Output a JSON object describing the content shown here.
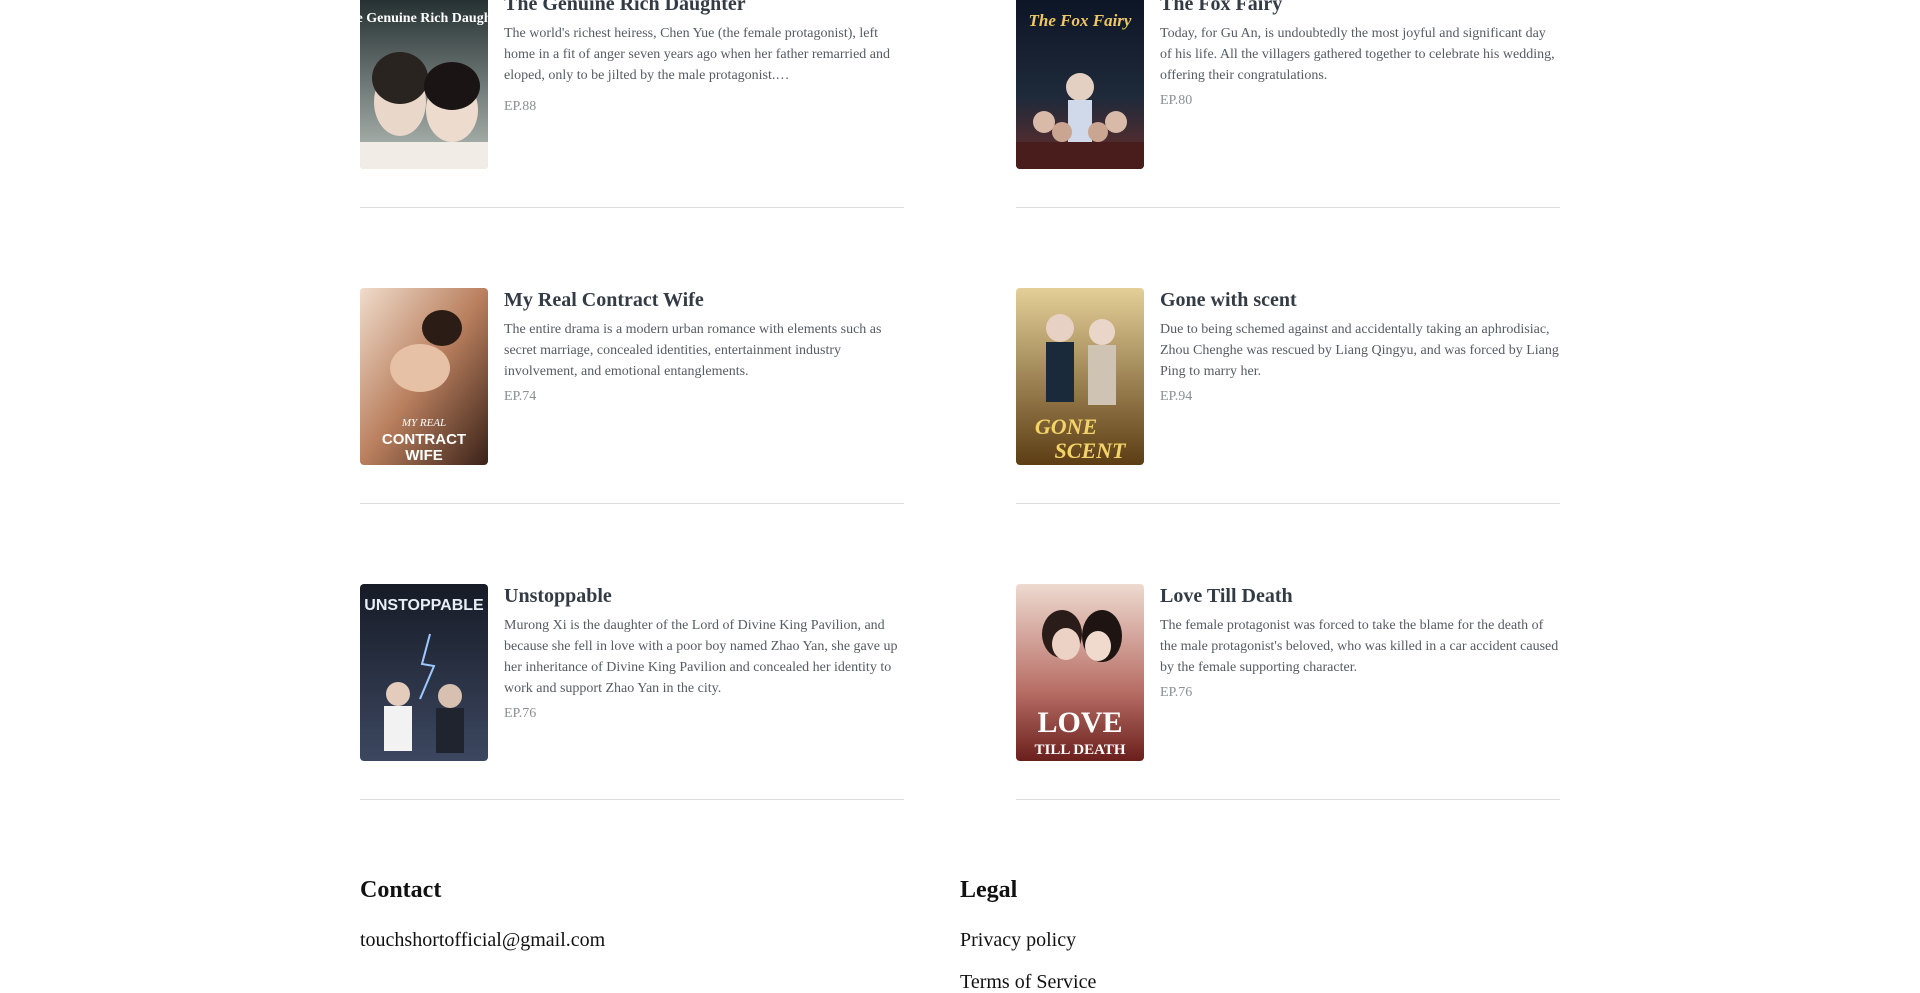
{
  "dramas": [
    {
      "title": "The Genuine Rich Daughter",
      "description": "The world's richest heiress, Chen Yue (the female protagonist), left home in a fit of anger seven years ago when her father remarried and eloped, only to be jilted by the male protagonist.…",
      "episodes": "EP.88",
      "poster_text": "The Genuine Rich Daughter",
      "poster_colors": [
        "#2e3a3a",
        "#a7b2ab"
      ]
    },
    {
      "title": "The Fox Fairy",
      "description": "Today, for Gu An, is undoubtedly the most joyful and significant day of his life. All the villagers gathered together to celebrate his wedding, offering their congratulations.",
      "episodes": "EP.80",
      "poster_text": "The Fox Fairy",
      "poster_colors": [
        "#0f1a2e",
        "#5a2a2a"
      ]
    },
    {
      "title": "My Real Contract Wife",
      "description": "The entire drama is a modern urban romance with elements such as secret marriage, concealed identities, entertainment industry involvement, and emotional entanglements.",
      "episodes": "EP.74",
      "poster_text": "MY REAL CONTRACT WIFE",
      "poster_colors": [
        "#c48a6a",
        "#4a2a1e"
      ]
    },
    {
      "title": "Gone with scent",
      "description": "Due to being schemed against and accidentally taking an aphrodisiac, Zhou Chenghe was rescued by Liang Qingyu, and was forced by Liang Ping to marry her.",
      "episodes": "EP.94",
      "poster_text": "GONE WITH SCENT",
      "poster_colors": [
        "#d7b97a",
        "#6b4a1c"
      ]
    },
    {
      "title": "Unstoppable",
      "description": "Murong Xi is the daughter of the Lord of Divine King Pavilion, and because she fell in love with a poor boy named Zhao Yan, she gave up her inheritance of Divine King Pavilion and concealed her identity to work and support Zhao Yan in the city.",
      "episodes": "EP.76",
      "poster_text": "UNSTOPPABLE",
      "poster_colors": [
        "#1b2230",
        "#4d5a72"
      ]
    },
    {
      "title": "Love Till Death",
      "description": "The female protagonist was forced to take the blame for the death of the male protagonist's beloved, who was killed in a car accident caused by the female supporting character.",
      "episodes": "EP.76",
      "poster_text": "LOVE TILL DEATH",
      "poster_colors": [
        "#e6cfc4",
        "#7a2a24"
      ]
    }
  ],
  "footer": {
    "contact": {
      "heading": "Contact",
      "email": "touchshortofficial@gmail.com"
    },
    "legal": {
      "heading": "Legal",
      "privacy": "Privacy policy",
      "terms": "Terms of Service"
    }
  }
}
